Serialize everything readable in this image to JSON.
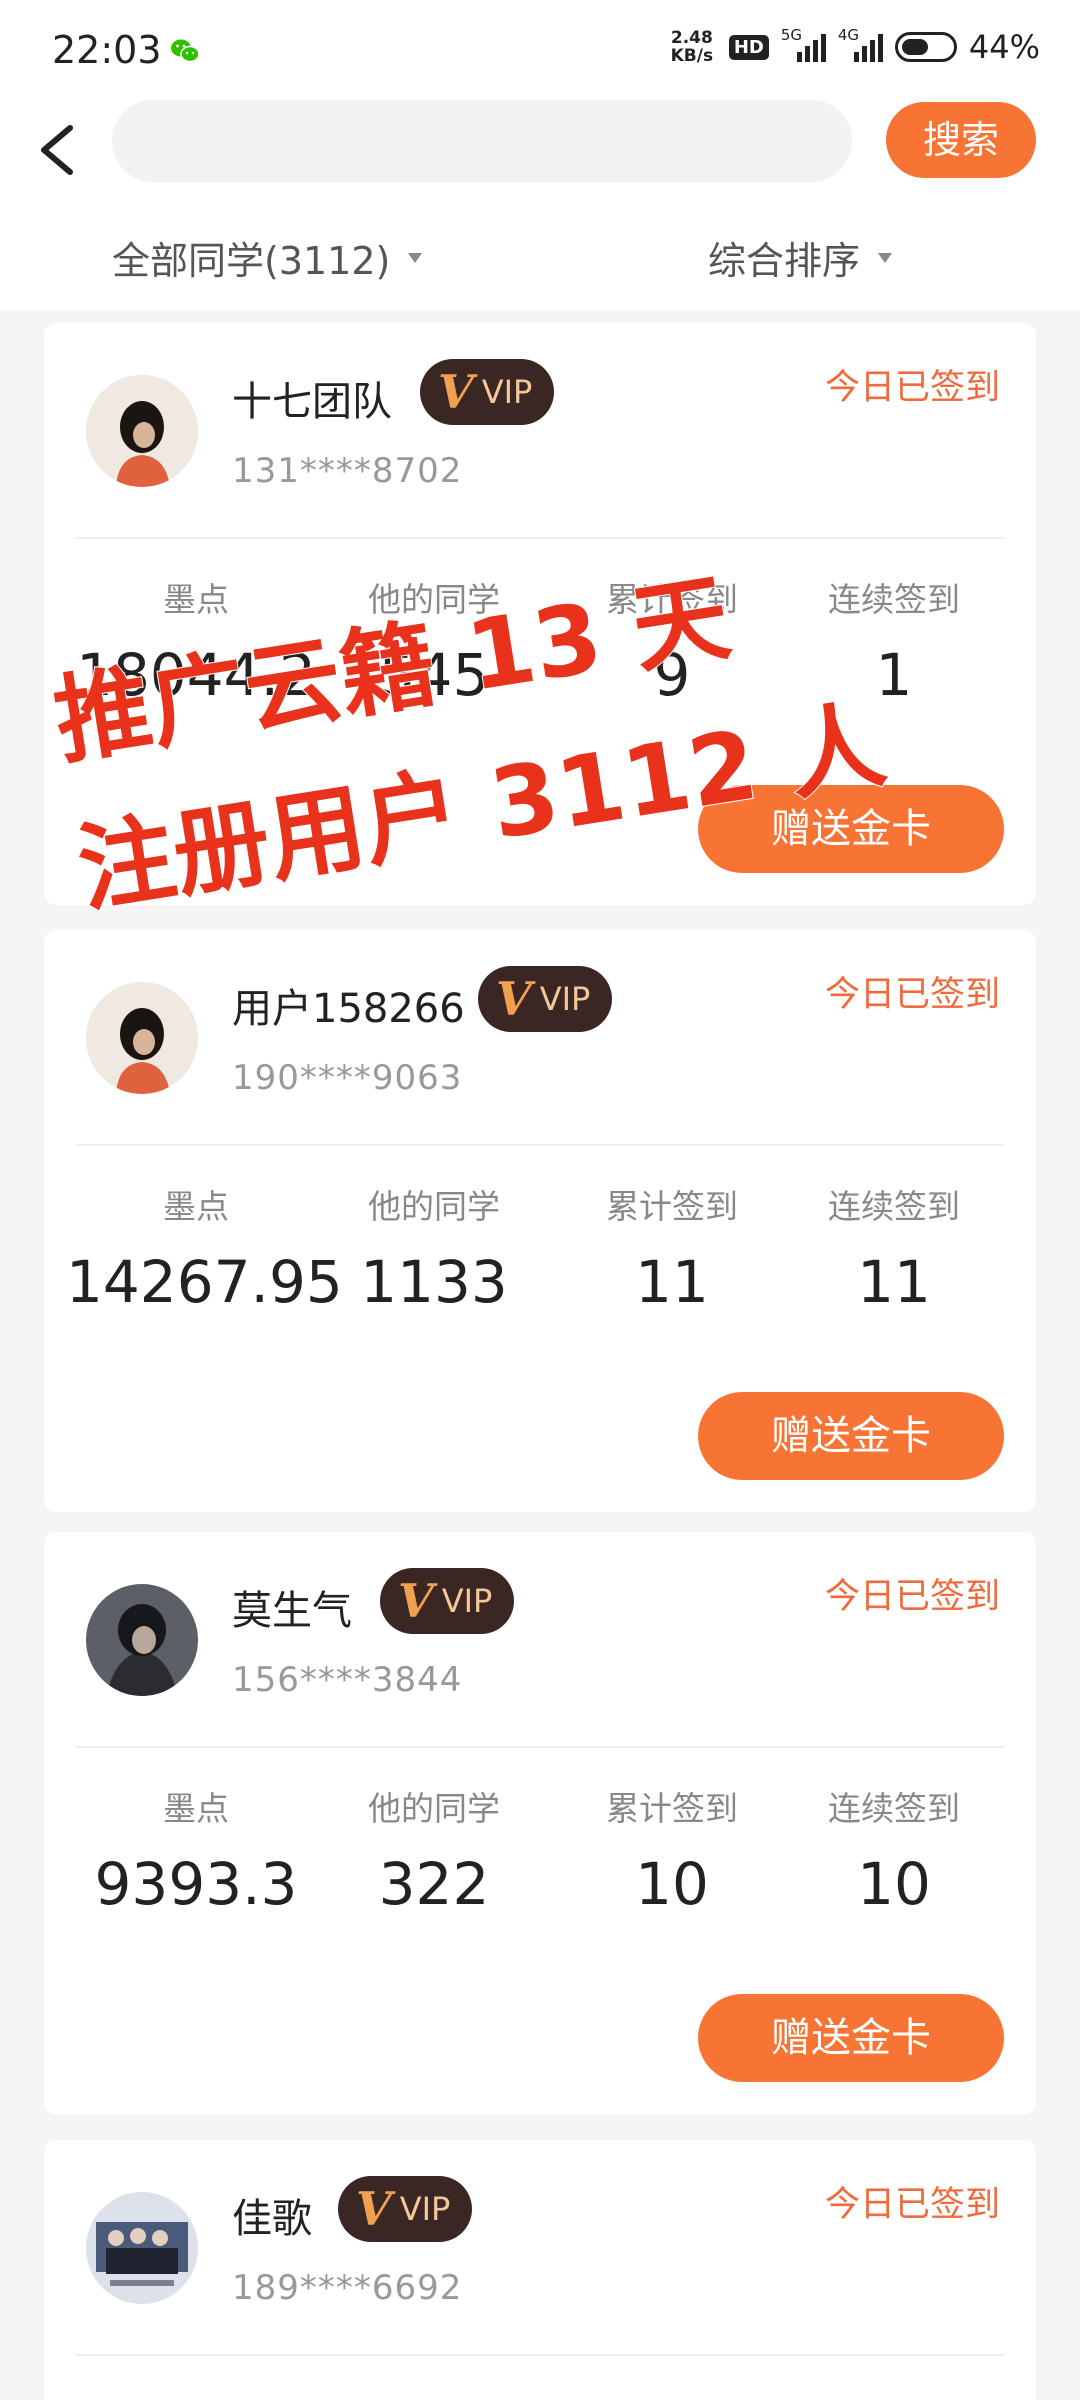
{
  "status_bar": {
    "time": "22:03",
    "net_speed_value": "2.48",
    "net_speed_unit": "KB/s",
    "hd": "HD",
    "signal_5g": "5G",
    "signal_4g": "4G",
    "battery": "44%",
    "icons": [
      "wechat-icon",
      "signal-icon",
      "battery-icon"
    ]
  },
  "search": {
    "placeholder": "",
    "button_label": "搜索"
  },
  "filters": {
    "all_label": "全部同学(3112)",
    "sort_label": "综合排序"
  },
  "stat_labels": [
    "墨点",
    "他的同学",
    "累计签到",
    "连续签到"
  ],
  "gift_label": "赠送金卡",
  "vip_label": "VIP",
  "vip_letter": "V",
  "users": [
    {
      "name": "十七团队",
      "phone": "131****8702",
      "sign_status": "今日已签到",
      "points": "18044.2",
      "classmates": "545",
      "total_sign": "9",
      "streak": "1"
    },
    {
      "name": "用户158266",
      "phone": "190****9063",
      "sign_status": "今日已签到",
      "points": "14267.95",
      "classmates": "1133",
      "total_sign": "11",
      "streak": "11"
    },
    {
      "name": "莫生气",
      "phone": "156****3844",
      "sign_status": "今日已签到",
      "points": "9393.3",
      "classmates": "322",
      "total_sign": "10",
      "streak": "10"
    },
    {
      "name": "佳歌",
      "phone": "189****6692",
      "sign_status": "今日已签到",
      "points": "",
      "classmates": "",
      "total_sign": "",
      "streak": ""
    }
  ],
  "overlay": {
    "line1": "推广云籍 13 天",
    "line2": "注册用户 3112 人",
    "color": "#e8321c"
  },
  "colors": {
    "accent": "#f77435",
    "sign": "#ef6a3d",
    "vip_bg": "#3a2622"
  }
}
